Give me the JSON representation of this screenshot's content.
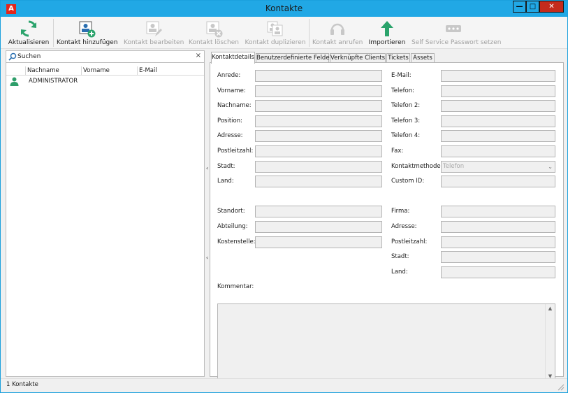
{
  "window": {
    "title": "Kontakte",
    "app_icon_letter": "A"
  },
  "toolbar": {
    "refresh": "Aktualisieren",
    "add": "Kontakt hinzufügen",
    "edit": "Kontakt bearbeiten",
    "delete": "Kontakt löschen",
    "duplicate": "Kontakt duplizieren",
    "call": "Kontakt anrufen",
    "import": "Importieren",
    "ssp": "Self Service Passwort setzen"
  },
  "search": {
    "placeholder": "Suchen",
    "clear": "×"
  },
  "grid": {
    "columns": [
      "Nachname",
      "Vorname",
      "E-Mail"
    ],
    "rows": [
      {
        "nachname": "ADMINISTRATOR",
        "vorname": "",
        "email": ""
      }
    ]
  },
  "tabs": [
    "Kontaktdetails",
    "Benutzerdefinierte Felder",
    "Verknüpfte Clients",
    "Tickets",
    "Assets"
  ],
  "form": {
    "left": [
      "Anrede:",
      "Vorname:",
      "Nachname:",
      "Position:",
      "Adresse:",
      "Postleitzahl:",
      "Stadt:",
      "Land:"
    ],
    "right": [
      "E-Mail:",
      "Telefon:",
      "Telefon 2:",
      "Telefon 3:",
      "Telefon 4:",
      "Fax:",
      "Kontaktmethode:",
      "Custom ID:"
    ],
    "contact_method_value": "Telefon",
    "left2": [
      "Standort:",
      "Abteilung:",
      "Kostenstelle:"
    ],
    "right2": [
      "Firma:",
      "Adresse:",
      "Postleitzahl:",
      "Stadt:",
      "Land:"
    ],
    "comment": "Kommentar:"
  },
  "status": {
    "text": "1 Kontakte"
  },
  "colors": {
    "titlebar": "#21a8e5",
    "close": "#c42b1c",
    "refresh_green": "#2aa36b",
    "person_green": "#2e9e6a"
  }
}
